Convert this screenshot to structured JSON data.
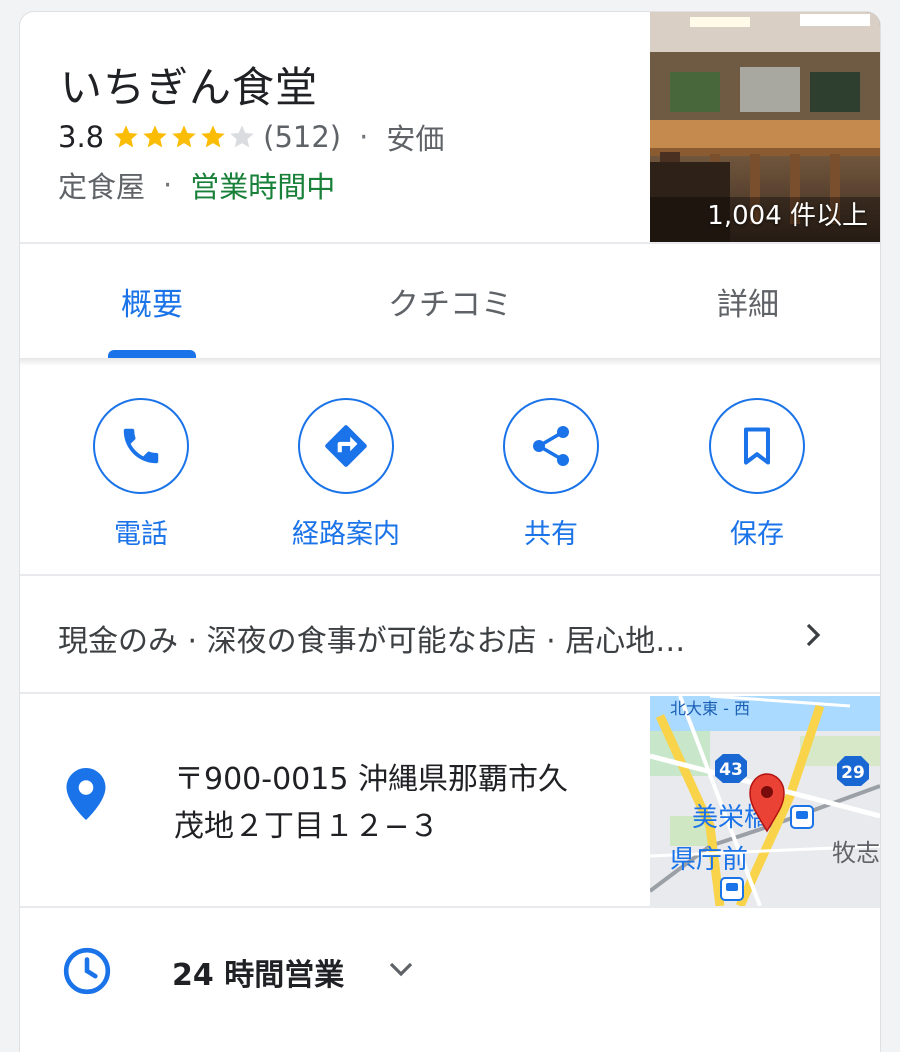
{
  "place": {
    "name": "いちぎん食堂",
    "rating": "3.8",
    "rating_value": 3.8,
    "review_count": "(512)",
    "price": "安価",
    "category": "定食屋",
    "open_status": "営業時間中",
    "photo_count": "1,004 件以上",
    "separator": "·"
  },
  "tabs": [
    {
      "label": "概要"
    },
    {
      "label": "クチコミ"
    },
    {
      "label": "詳細"
    }
  ],
  "actions": [
    {
      "label": "電話",
      "icon": "phone-icon"
    },
    {
      "label": "経路案内",
      "icon": "directions-icon"
    },
    {
      "label": "共有",
      "icon": "share-icon"
    },
    {
      "label": "保存",
      "icon": "bookmark-icon"
    }
  ],
  "features": {
    "text": "現金のみ · 深夜の食事が可能なお店 · 居心地…"
  },
  "address": {
    "line1": "〒900-0015 沖縄県那覇市久",
    "line2": "茂地２丁目１２−３"
  },
  "map": {
    "labels": {
      "road43": "43",
      "road29": "29",
      "station1": "美栄橋",
      "station2": "県庁前",
      "area1": "牧志",
      "road_name": "北大東 - 西"
    }
  },
  "hours": {
    "text": "24 時間営業"
  },
  "colors": {
    "accent": "#1a73e8",
    "open": "#188038",
    "star": "#fbbc04",
    "star_empty": "#dadce0",
    "pin": "#ea4335"
  }
}
